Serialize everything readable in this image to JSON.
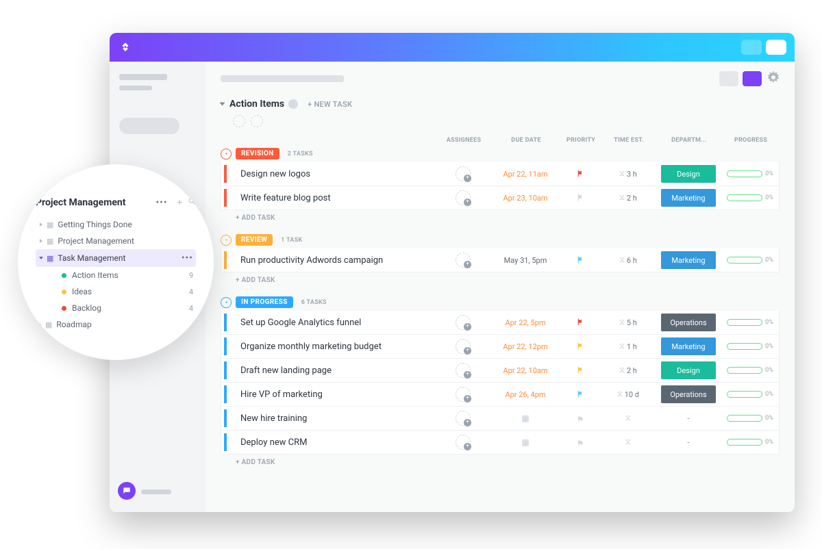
{
  "list": {
    "title": "Action Items",
    "new_task_label": "+ NEW TASK",
    "add_task_label": "+ ADD TASK"
  },
  "columns": {
    "assignees": "ASSIGNEES",
    "due_date": "DUE DATE",
    "priority": "PRIORITY",
    "time_est": "TIME EST.",
    "department": "DEPARTM...",
    "progress": "PROGRESS"
  },
  "statuses": [
    {
      "key": "revision",
      "label": "REVISION",
      "count_label": "2 TASKS",
      "tasks": [
        {
          "name": "Design new logos",
          "due": "Apr 22, 11am",
          "due_color": "orange",
          "flag": "red",
          "time": "3 h",
          "dept": "Design",
          "dept_class": "dept-design",
          "progress": "0%"
        },
        {
          "name": "Write feature blog post",
          "due": "Apr 23, 10am",
          "due_color": "orange",
          "flag": "gray",
          "time": "2 h",
          "dept": "Marketing",
          "dept_class": "dept-marketing",
          "progress": "0%"
        }
      ]
    },
    {
      "key": "review",
      "label": "REVIEW",
      "count_label": "1 TASK",
      "tasks": [
        {
          "name": "Run productivity Adwords campaign",
          "due": "May 31, 5pm",
          "due_color": "gray",
          "flag": "blue",
          "time": "6 h",
          "dept": "Marketing",
          "dept_class": "dept-marketing",
          "progress": "0%"
        }
      ]
    },
    {
      "key": "inprogress",
      "label": "IN PROGRESS",
      "count_label": "6 TASKS",
      "tasks": [
        {
          "name": "Set up Google Analytics funnel",
          "due": "Apr 22, 5pm",
          "due_color": "orange",
          "flag": "red",
          "time": "5 h",
          "dept": "Operations",
          "dept_class": "dept-operations",
          "progress": "0%"
        },
        {
          "name": "Organize monthly marketing budget",
          "due": "Apr 22, 12pm",
          "due_color": "orange",
          "flag": "yellow",
          "time": "1 h",
          "dept": "Marketing",
          "dept_class": "dept-marketing",
          "progress": "0%"
        },
        {
          "name": "Draft new landing page",
          "due": "Apr 22, 10am",
          "due_color": "orange",
          "flag": "yellow",
          "time": "2 h",
          "dept": "Design",
          "dept_class": "dept-design",
          "progress": "0%"
        },
        {
          "name": "Hire VP of marketing",
          "due": "Apr 26, 4pm",
          "due_color": "orange",
          "flag": "blue",
          "time": "10 d",
          "dept": "Operations",
          "dept_class": "dept-operations",
          "progress": "0%"
        },
        {
          "name": "New hire training",
          "due": "",
          "due_color": "",
          "flag": "",
          "time": "",
          "dept": "-",
          "dept_class": "dept-none",
          "progress": "0%"
        },
        {
          "name": "Deploy new CRM",
          "due": "",
          "due_color": "",
          "flag": "",
          "time": "",
          "dept": "-",
          "dept_class": "dept-none",
          "progress": "0%"
        }
      ]
    }
  ],
  "sidebar": {
    "title": "Project Management",
    "folders": [
      {
        "label": "Getting Things Done"
      },
      {
        "label": "Project Management"
      },
      {
        "label": "Task Management",
        "selected": true
      }
    ],
    "lists": [
      {
        "label": "Action Items",
        "count": "9",
        "dot": "dot-green"
      },
      {
        "label": "Ideas",
        "count": "4",
        "dot": "dot-yellow"
      },
      {
        "label": "Backlog",
        "count": "4",
        "dot": "dot-red"
      }
    ],
    "roadmap": "Roadmap"
  },
  "flag_colors": {
    "red": "#e74c3c",
    "gray": "#cfd5dd",
    "blue": "#5dc7ff",
    "yellow": "#f4c542"
  }
}
